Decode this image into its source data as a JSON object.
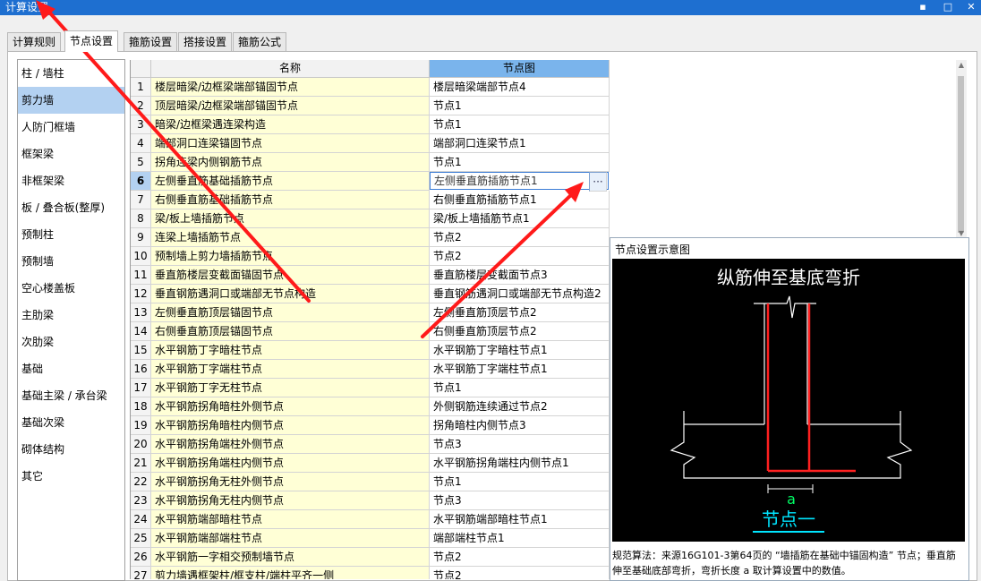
{
  "window": {
    "title": "计算设置",
    "controls": [
      "▪",
      "□",
      "✕"
    ]
  },
  "tabs": [
    {
      "label": "计算规则",
      "active": false
    },
    {
      "label": "节点设置",
      "active": true
    },
    {
      "label": "箍筋设置",
      "active": false
    },
    {
      "label": "搭接设置",
      "active": false
    },
    {
      "label": "箍筋公式",
      "active": false
    }
  ],
  "categories": [
    "柱 / 墙柱",
    "剪力墙",
    "人防门框墙",
    "框架梁",
    "非框架梁",
    "板 / 叠合板(整厚)",
    "预制柱",
    "预制墙",
    "空心楼盖板",
    "主肋梁",
    "次肋梁",
    "基础",
    "基础主梁 / 承台梁",
    "基础次梁",
    "砌体结构",
    "其它"
  ],
  "selected_category": 1,
  "grid": {
    "headers": {
      "name": "名称",
      "node": "节点图"
    },
    "selected_row": 5,
    "ellipsis": "···",
    "rows": [
      {
        "num": "1",
        "name": "楼层暗梁/边框梁端部锚固节点",
        "node": "楼层暗梁端部节点4"
      },
      {
        "num": "2",
        "name": "顶层暗梁/边框梁端部锚固节点",
        "node": "节点1"
      },
      {
        "num": "3",
        "name": "暗梁/边框梁遇连梁构造",
        "node": "节点1"
      },
      {
        "num": "4",
        "name": "端部洞口连梁锚固节点",
        "node": "端部洞口连梁节点1"
      },
      {
        "num": "5",
        "name": "拐角连梁内侧钢筋节点",
        "node": "节点1"
      },
      {
        "num": "6",
        "name": "左侧垂直筋基础插筋节点",
        "node": "左侧垂直筋插筋节点1"
      },
      {
        "num": "7",
        "name": "右侧垂直筋基础插筋节点",
        "node": "右侧垂直筋插筋节点1"
      },
      {
        "num": "8",
        "name": "梁/板上墙插筋节点",
        "node": "梁/板上墙插筋节点1"
      },
      {
        "num": "9",
        "name": "连梁上墙插筋节点",
        "node": "节点2"
      },
      {
        "num": "10",
        "name": "预制墙上剪力墙插筋节点",
        "node": "节点2"
      },
      {
        "num": "11",
        "name": "垂直筋楼层变截面锚固节点",
        "node": "垂直筋楼层变截面节点3"
      },
      {
        "num": "12",
        "name": "垂直钢筋遇洞口或端部无节点构造",
        "node": "垂直钢筋遇洞口或端部无节点构造2"
      },
      {
        "num": "13",
        "name": "左侧垂直筋顶层锚固节点",
        "node": "左侧垂直筋顶层节点2"
      },
      {
        "num": "14",
        "name": "右侧垂直筋顶层锚固节点",
        "node": "右侧垂直筋顶层节点2"
      },
      {
        "num": "15",
        "name": "水平钢筋丁字暗柱节点",
        "node": "水平钢筋丁字暗柱节点1"
      },
      {
        "num": "16",
        "name": "水平钢筋丁字端柱节点",
        "node": "水平钢筋丁字端柱节点1"
      },
      {
        "num": "17",
        "name": "水平钢筋丁字无柱节点",
        "node": "节点1"
      },
      {
        "num": "18",
        "name": "水平钢筋拐角暗柱外侧节点",
        "node": "外侧钢筋连续通过节点2"
      },
      {
        "num": "19",
        "name": "水平钢筋拐角暗柱内侧节点",
        "node": "拐角暗柱内侧节点3"
      },
      {
        "num": "20",
        "name": "水平钢筋拐角端柱外侧节点",
        "node": "节点3"
      },
      {
        "num": "21",
        "name": "水平钢筋拐角端柱内侧节点",
        "node": "水平钢筋拐角端柱内侧节点1"
      },
      {
        "num": "22",
        "name": "水平钢筋拐角无柱外侧节点",
        "node": "节点1"
      },
      {
        "num": "23",
        "name": "水平钢筋拐角无柱内侧节点",
        "node": "节点3"
      },
      {
        "num": "24",
        "name": "水平钢筋端部暗柱节点",
        "node": "水平钢筋端部暗柱节点1"
      },
      {
        "num": "25",
        "name": "水平钢筋端部端柱节点",
        "node": "端部端柱节点1"
      },
      {
        "num": "26",
        "name": "水平钢筋一字相交预制墙节点",
        "node": "节点2"
      },
      {
        "num": "27",
        "name": "剪力墙遇框架柱/框支柱/端柱平齐一侧",
        "node": "节点2"
      }
    ]
  },
  "preview": {
    "title": "节点设置示意图",
    "diagram_heading": "纵筋伸至基底弯折",
    "dim_label": "a",
    "node_caption": "节点一",
    "description": "规范算法：来源16G101-3第64页的 “墙插筋在基础中锚固构造” 节点；垂直筋伸至基础底部弯折，弯折长度 a 取计算设置中的数值。",
    "colors": {
      "bg": "#000000",
      "line": "#ffffff",
      "rebar": "#ff2020",
      "dim": "#00ff66",
      "caption": "#00e5ff"
    }
  },
  "annotation_color": "#ff1a1a"
}
